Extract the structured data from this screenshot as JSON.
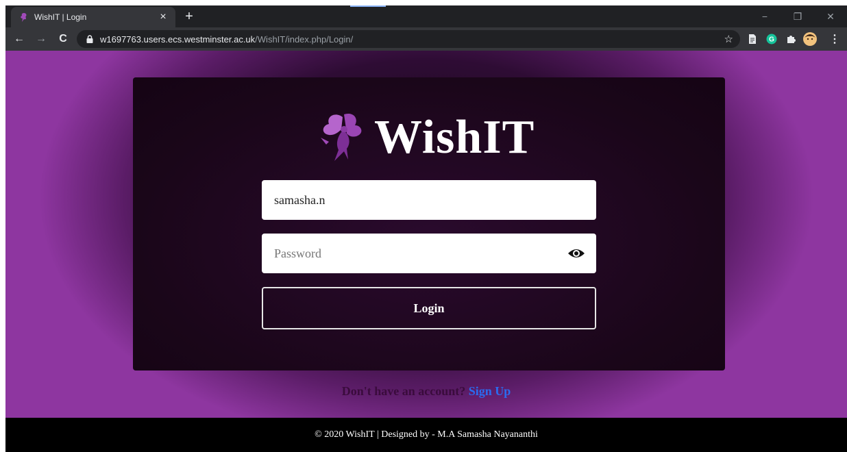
{
  "browser": {
    "tab_title": "WishIT | Login",
    "close_tab": "×",
    "new_tab": "+",
    "url_host": "w1697763.users.ecs.westminster.ac.uk",
    "url_path": "/WishIT/index.php/Login/",
    "back": "←",
    "forward": "→",
    "reload": "C",
    "bookmark_star": "☆",
    "window_controls": {
      "minimize": "−",
      "restore": "❐",
      "close": "✕"
    },
    "extension_icons": [
      "document-icon",
      "grammarly-icon",
      "puzzle-icon",
      "profile-avatar-icon"
    ]
  },
  "login": {
    "brand": "WishIT",
    "username_value": "samasha.n",
    "password_placeholder": "Password",
    "login_label": "Login"
  },
  "signup": {
    "question": "Don't have an account?",
    "link": "Sign Up"
  },
  "footer": {
    "text": "© 2020 WishIT | Designed by - M.A Samasha Nayananthi"
  },
  "colors": {
    "accent_purple": "#8e36a0",
    "card_bg": "#1a0619",
    "link_blue": "#2b6cf0",
    "footer_bg": "#000000"
  }
}
